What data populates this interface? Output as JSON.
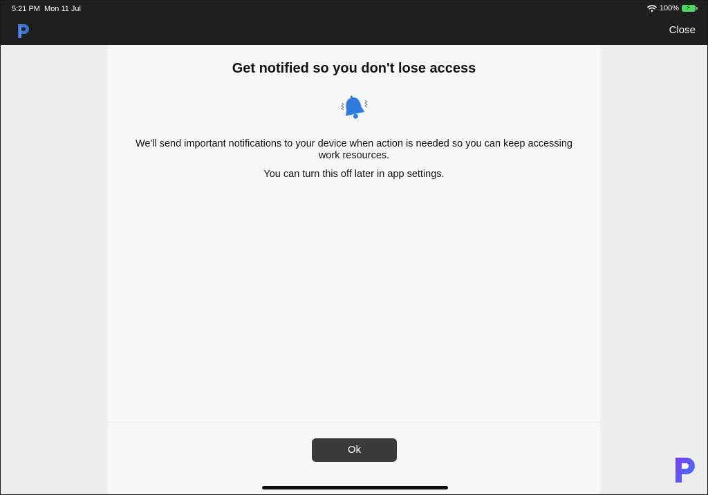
{
  "status_bar": {
    "time": "5:21 PM",
    "date": "Mon 11 Jul",
    "battery": "100%",
    "icons": [
      "wifi-icon",
      "battery-charging-icon"
    ]
  },
  "nav": {
    "logo_icon": "app-logo-icon",
    "close_label": "Close"
  },
  "dialog": {
    "title": "Get notified so you don't lose access",
    "icon": "bell-ringing-icon",
    "body_1": "We'll send important notifications to your device when action is needed so you can keep accessing work resources.",
    "body_2": "You can turn this off later in app settings.",
    "ok_label": "Ok"
  },
  "colors": {
    "header_bg": "#1f1f1f",
    "panel_bg": "#f7f7f7",
    "button_bg": "#3a3a3a",
    "bell_blue": "#2f7ce0",
    "battery_green": "#4cd964"
  }
}
